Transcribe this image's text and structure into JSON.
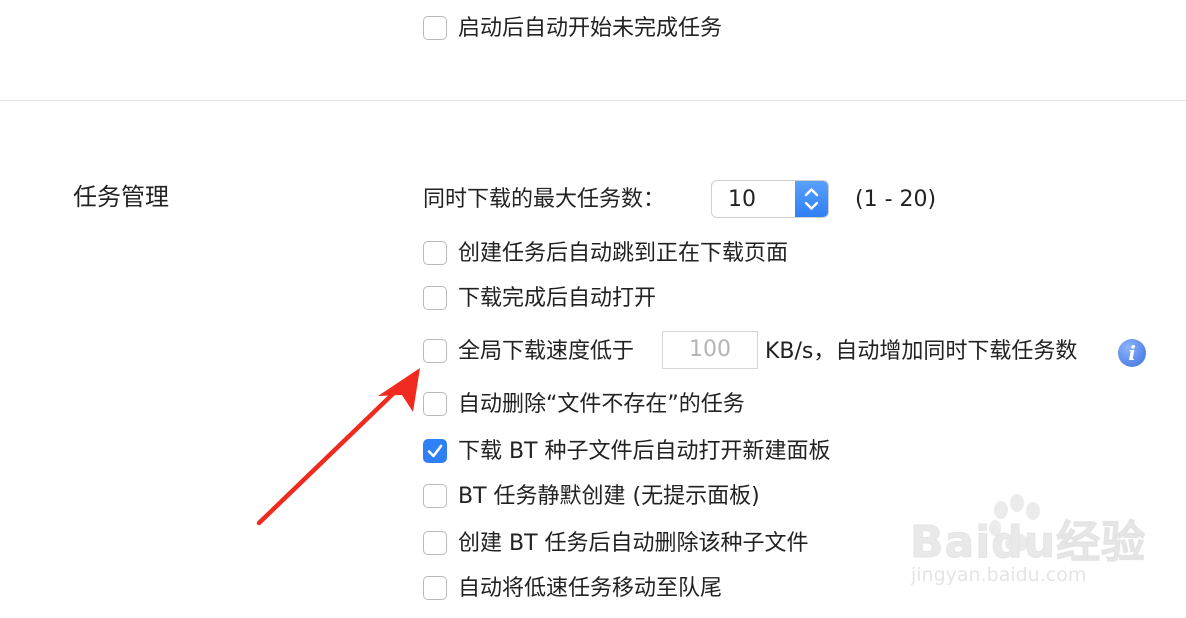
{
  "top_option": {
    "label": "启动后自动开始未完成任务",
    "checked": false
  },
  "section": {
    "title": "任务管理",
    "max_tasks": {
      "label": "同时下载的最大任务数：",
      "value": "10",
      "range": "(1 - 20)"
    },
    "options": [
      {
        "label": "创建任务后自动跳到正在下载页面",
        "checked": false
      },
      {
        "label": "下载完成后自动打开",
        "checked": false
      },
      {
        "label": "全局下载速度低于",
        "checked": false,
        "input_value": "100",
        "suffix": "KB/s，自动增加同时下载任务数"
      },
      {
        "label": "自动删除“文件不存在”的任务",
        "checked": false
      },
      {
        "label": "下载 BT 种子文件后自动打开新建面板",
        "checked": true
      },
      {
        "label": "BT 任务静默创建 (无提示面板)",
        "checked": false
      },
      {
        "label": "创建 BT 任务后自动删除该种子文件",
        "checked": false
      },
      {
        "label": "自动将低速任务移动至队尾",
        "checked": false
      }
    ]
  },
  "info_icon": {
    "icon": "info-icon",
    "glyph": "i"
  },
  "watermark": {
    "logo": "Baidu经验",
    "url": "jingyan.baidu.com"
  },
  "colors": {
    "accent": "#2f7ff6",
    "arrow": "#f02a1e",
    "divider": "#e3e3e3"
  }
}
